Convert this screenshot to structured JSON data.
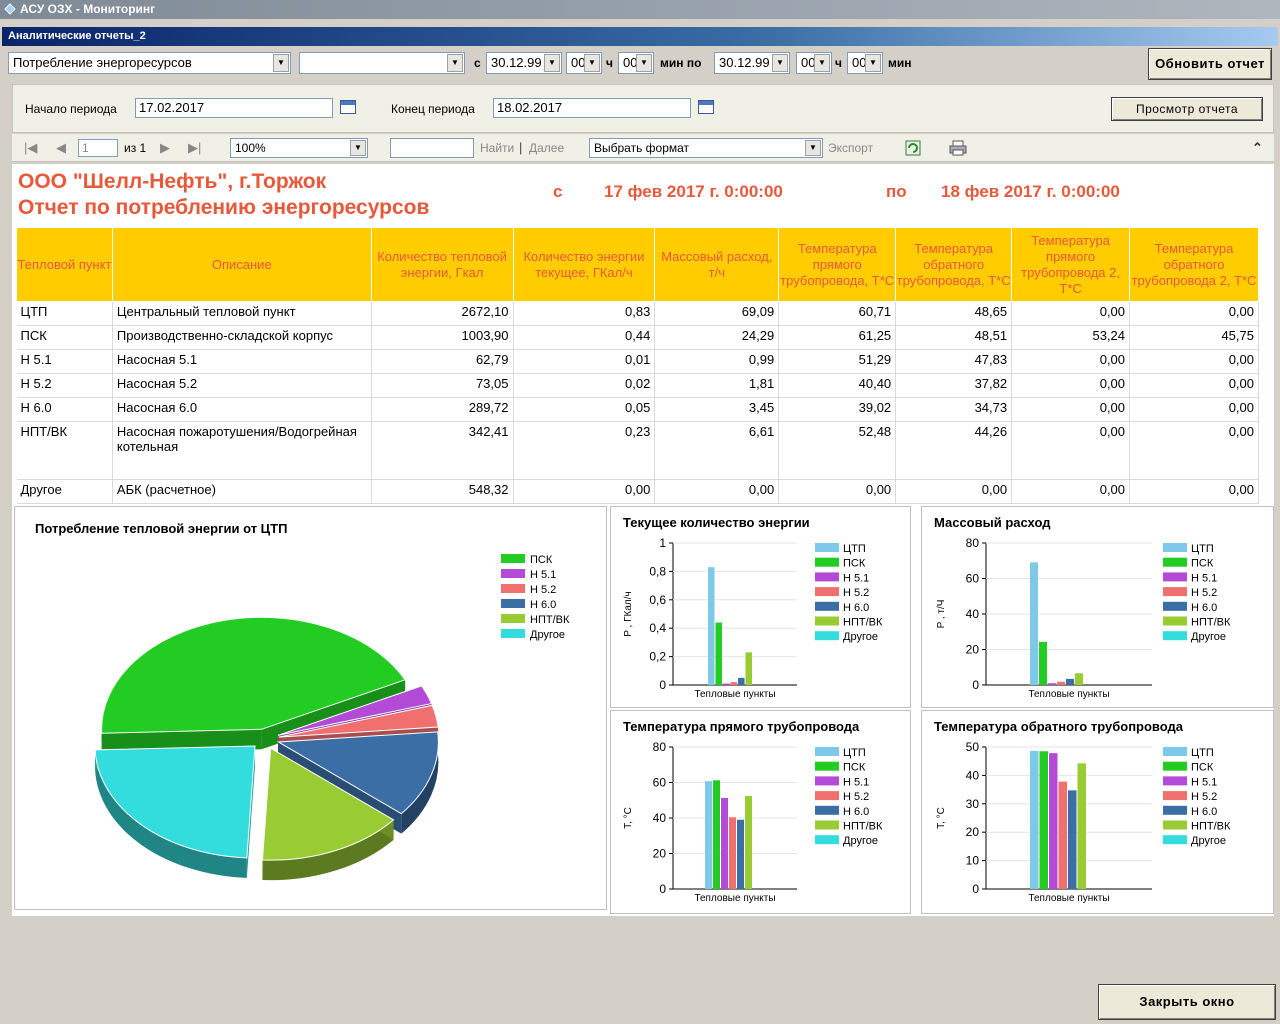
{
  "window": {
    "title": "АСУ ОЗХ - Мониторинг"
  },
  "form": {
    "title": "Аналитические отчеты_2"
  },
  "filter": {
    "report_type": "Потребление энергоресурсов",
    "second_combo": "",
    "from_label": "с",
    "from_date": "30.12.99",
    "from_hour": "00",
    "hour_label": "ч",
    "from_min": "00",
    "min_label_to": "мин по",
    "to_date": "30.12.99",
    "to_hour": "00",
    "to_min": "00",
    "min_label": "мин",
    "refresh_button": "Обновить отчет"
  },
  "params": {
    "start_label": "Начало периода",
    "start_value": "17.02.2017",
    "end_label": "Конец периода",
    "end_value": "18.02.2017",
    "view_button": "Просмотр отчета"
  },
  "viewer_toolbar": {
    "page_value": "1",
    "page_of": "из 1",
    "zoom": "100%",
    "find_placeholder": "",
    "find_label": "Найти",
    "next_label": "Далее",
    "format": "Выбрать формат",
    "export_label": "Экспорт"
  },
  "report": {
    "company": "ООО \"Шелл-Нефть\", г.Торжок",
    "title": "Отчет по потреблению энергоресурсов",
    "from_word": "с",
    "from_date": "17 фев 2017 г. 0:00:00",
    "to_word": "по",
    "to_date": "18 фев 2017 г. 0:00:00",
    "columns": [
      "Тепловой пункт",
      "Описание",
      "Количество тепловой энергии, Гкал",
      "Количество энергии текущее, ГКал/ч",
      "Массовый расход, т/ч",
      "Температура прямого трубопровода, T*C",
      "Температура обратного трубопровода, T*C",
      "Температура прямого трубопровода 2, T*C",
      "Температура обратного трубопровода 2, T*C"
    ],
    "rows": [
      [
        "ЦТП",
        "Центральный тепловой пункт",
        "2672,10",
        "0,83",
        "69,09",
        "60,71",
        "48,65",
        "0,00",
        "0,00"
      ],
      [
        "ПСК",
        "Производственно-складской корпус",
        "1003,90",
        "0,44",
        "24,29",
        "61,25",
        "48,51",
        "53,24",
        "45,75"
      ],
      [
        "Н 5.1",
        "Насосная 5.1",
        "62,79",
        "0,01",
        "0,99",
        "51,29",
        "47,83",
        "0,00",
        "0,00"
      ],
      [
        "Н 5.2",
        "Насосная 5.2",
        "73,05",
        "0,02",
        "1,81",
        "40,40",
        "37,82",
        "0,00",
        "0,00"
      ],
      [
        "Н 6.0",
        "Насосная 6.0",
        "289,72",
        "0,05",
        "3,45",
        "39,02",
        "34,73",
        "0,00",
        "0,00"
      ],
      [
        "НПТ/ВК",
        "Насосная пожаротушения/Водогрейная котельная",
        "342,41",
        "0,23",
        "6,61",
        "52,48",
        "44,26",
        "0,00",
        "0,00"
      ],
      [
        "Другое",
        "АБК (расчетное)",
        "548,32",
        "0,00",
        "0,00",
        "0,00",
        "0,00",
        "0,00",
        "0,00"
      ]
    ]
  },
  "colors": {
    "ЦТП": "#7ec8e8",
    "ПСК": "#22cc22",
    "Н 5.1": "#b44ad8",
    "Н 5.2": "#f07070",
    "Н 6.0": "#3a6ea5",
    "НПТ/ВК": "#99cc33",
    "Другое": "#33dddd",
    "accent": "#e8593b",
    "header_fill": "#ffcc00"
  },
  "chart_data": [
    {
      "type": "pie",
      "title": "Потребление тепловой энергии от ЦТП",
      "categories": [
        "ПСК",
        "Н 5.1",
        "Н 5.2",
        "Н 6.0",
        "НПТ/ВК",
        "Другое"
      ],
      "legend": [
        "ПСК",
        "Н 5.1",
        "Н 5.2",
        "Н 6.0",
        "НПТ/ВК",
        "Другое"
      ],
      "values": [
        1003.9,
        62.79,
        73.05,
        289.72,
        342.41,
        548.32
      ],
      "legend_position": "right"
    },
    {
      "type": "bar",
      "title": "Текущее количество энергии",
      "ylabel": "P , ГКал/ч",
      "xlabel": "Тепловые пункты",
      "ylim": [
        0,
        1
      ],
      "yticks": [
        "0",
        "0,2",
        "0,4",
        "0,6",
        "0,8",
        "1"
      ],
      "legend": [
        "ЦТП",
        "ПСК",
        "Н 5.1",
        "Н 5.2",
        "Н 6.0",
        "НПТ/ВК",
        "Другое"
      ],
      "values": [
        0.83,
        0.44,
        0.01,
        0.02,
        0.05,
        0.23,
        0.0
      ]
    },
    {
      "type": "bar",
      "title": "Массовый расход",
      "ylabel": "P , т/Ч",
      "xlabel": "Тепловые пункты",
      "ylim": [
        0,
        80
      ],
      "yticks": [
        "0",
        "20",
        "40",
        "60",
        "80"
      ],
      "legend": [
        "ЦТП",
        "ПСК",
        "Н 5.1",
        "Н 5.2",
        "Н 6.0",
        "НПТ/ВК",
        "Другое"
      ],
      "values": [
        69.09,
        24.29,
        0.99,
        1.81,
        3.45,
        6.61,
        0.0
      ]
    },
    {
      "type": "bar",
      "title": "Температура прямого трубопровода",
      "ylabel": "T, °C",
      "xlabel": "Тепловые пункты",
      "ylim": [
        0,
        80
      ],
      "yticks": [
        "0",
        "20",
        "40",
        "60",
        "80"
      ],
      "legend": [
        "ЦТП",
        "ПСК",
        "Н 5.1",
        "Н 5.2",
        "Н 6.0",
        "НПТ/ВК",
        "Другое"
      ],
      "values": [
        60.71,
        61.25,
        51.29,
        40.4,
        39.02,
        52.48,
        0.0
      ]
    },
    {
      "type": "bar",
      "title": "Температура обратного трубопровода",
      "ylabel": "T, °C",
      "xlabel": "Тепловые пункты",
      "ylim": [
        0,
        50
      ],
      "yticks": [
        "0",
        "10",
        "20",
        "30",
        "40",
        "50"
      ],
      "legend": [
        "ЦТП",
        "ПСК",
        "Н 5.1",
        "Н 5.2",
        "Н 6.0",
        "НПТ/ВК",
        "Другое"
      ],
      "values": [
        48.65,
        48.51,
        47.83,
        37.82,
        34.73,
        44.26,
        0.0
      ]
    }
  ],
  "footer": {
    "close_button": "Закрыть окно"
  }
}
